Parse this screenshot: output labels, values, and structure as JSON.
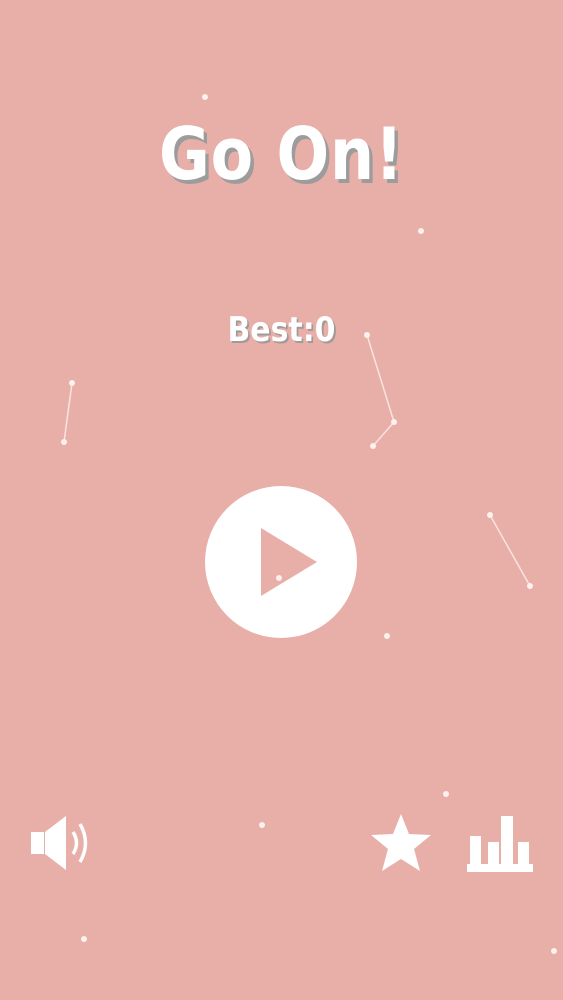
{
  "game": {
    "title": "Go On!",
    "best_score_label": "Best:0"
  },
  "controls": {
    "play": {
      "icon": "play-icon"
    },
    "sound": {
      "icon": "speaker-volume-icon"
    },
    "rate": {
      "icon": "star-icon"
    },
    "leaderboard": {
      "icon": "bar-chart-icon"
    }
  },
  "colors": {
    "background": "#e8afa9",
    "foreground": "#ffffff",
    "title_shadow": "#9c9c9c"
  }
}
